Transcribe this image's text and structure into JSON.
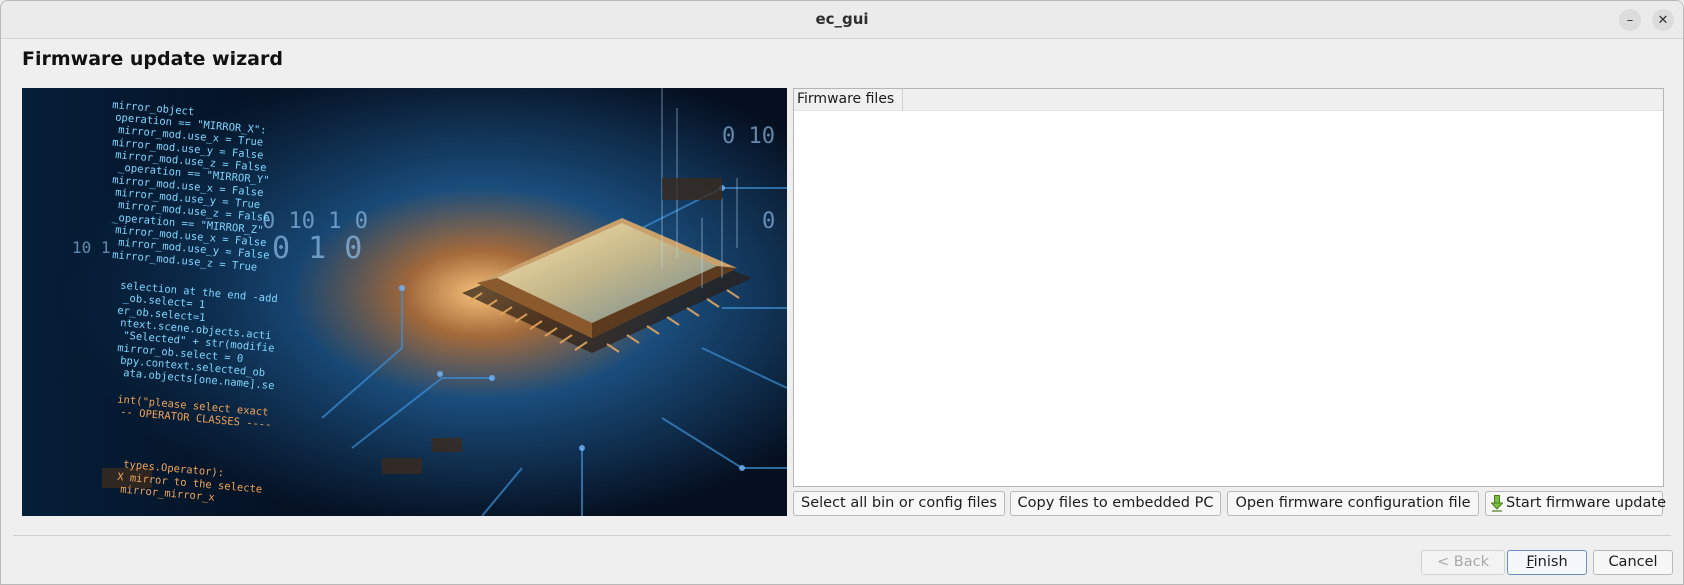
{
  "window": {
    "title": "ec_gui",
    "minimize_glyph": "–",
    "close_glyph": "✕"
  },
  "page": {
    "title": "Firmware update wizard"
  },
  "hero_code_lines": [
    "mirror_object",
    "operation == \"MIRROR_X\":",
    "mirror_mod.use_x = True",
    "mirror_mod.use_y = False",
    "mirror_mod.use_z = False",
    "_operation == \"MIRROR_Y\"",
    "mirror_mod.use_x = False",
    "mirror_mod.use_y = True",
    "mirror_mod.use_z = False",
    "_operation == \"MIRROR_Z\"",
    "mirror_mod.use_x = False",
    "mirror_mod.use_y = False",
    "mirror_mod.use_z = True",
    "selection at the end -add",
    "_ob.select= 1",
    "er_ob.select=1",
    "ntext.scene.objects.acti",
    "\"Selected\" + str(modifie",
    "mirror_ob.select = 0",
    "bpy.context.selected_ob",
    "ata.objects[one.name].se",
    "int(\"please select exact",
    "-- OPERATOR CLASSES ----",
    "types.Operator):",
    "X mirror to the selecte",
    "mirror_mirror_x"
  ],
  "firmware_list": {
    "column_header": "Firmware files",
    "rows": []
  },
  "actions": {
    "select_all": "Select all bin or config files",
    "copy_files": "Copy files to embedded PC",
    "open_config": "Open firmware configuration file",
    "start_update": "Start firmware update",
    "start_update_icon": "download-arrow-icon"
  },
  "footer": {
    "back": "< Back",
    "finish_mnemonic": "F",
    "finish_rest": "inish",
    "cancel": "Cancel"
  },
  "colors": {
    "accent_border": "#6a8fc2",
    "icon_green": "#7bc043"
  }
}
